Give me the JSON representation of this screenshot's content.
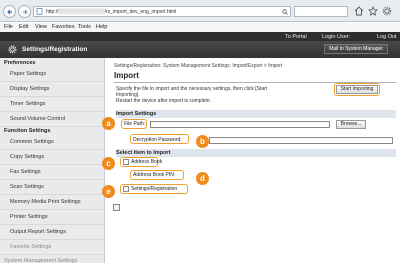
{
  "browser": {
    "url_prefix": "http://",
    "url_path": "/rs_import_dev_eng_import.html",
    "menu": [
      "File",
      "Edit",
      "View",
      "Favorites",
      "Tools",
      "Help"
    ]
  },
  "header": {
    "to_portal": "To Portal",
    "login_user_label": "Login User:",
    "logout": "Log Out",
    "title": "Settings/Registration",
    "mail_button": "Mail to System Manager"
  },
  "sidebar": {
    "preferences_heading": "Preferences",
    "preferences": [
      "Paper Settings",
      "Display Settings",
      "Timer Settings",
      "Sound Volume Control"
    ],
    "function_heading": "Function Settings",
    "functions": [
      "Common Settings",
      "Copy Settings",
      "Fax Settings",
      "Scan Settings",
      "Memory Media Print Settings",
      "Printer Settings",
      "Output Report Settings",
      "Favorite Settings"
    ],
    "bottom": "System Management Settings"
  },
  "main": {
    "breadcrumb": "Settings/Registration: System Management Settings: Import/Export > Import",
    "title": "Import",
    "instructions_1": "Specify the file to import and the necessary settings, then click [Start",
    "instructions_2": "Importing].",
    "instructions_3": "Restart the device after import is complete.",
    "start_button": "Start Importing",
    "import_settings_title": "Import Settings",
    "file_path_label": "File Path:",
    "browse_button": "Browse...",
    "decryption_password_label": "Decryption Password:",
    "select_items_title": "Select Item to Import",
    "address_book_label": "Address Book",
    "address_book_pin_label": "Address Book PIN:",
    "settings_registration_label": "Settings/Registration"
  },
  "callouts": [
    "a",
    "b",
    "c",
    "d",
    "e"
  ],
  "colors": {
    "callout": "#f08a1c",
    "highlight": "#f0a030",
    "header": "#3b3b3b"
  }
}
